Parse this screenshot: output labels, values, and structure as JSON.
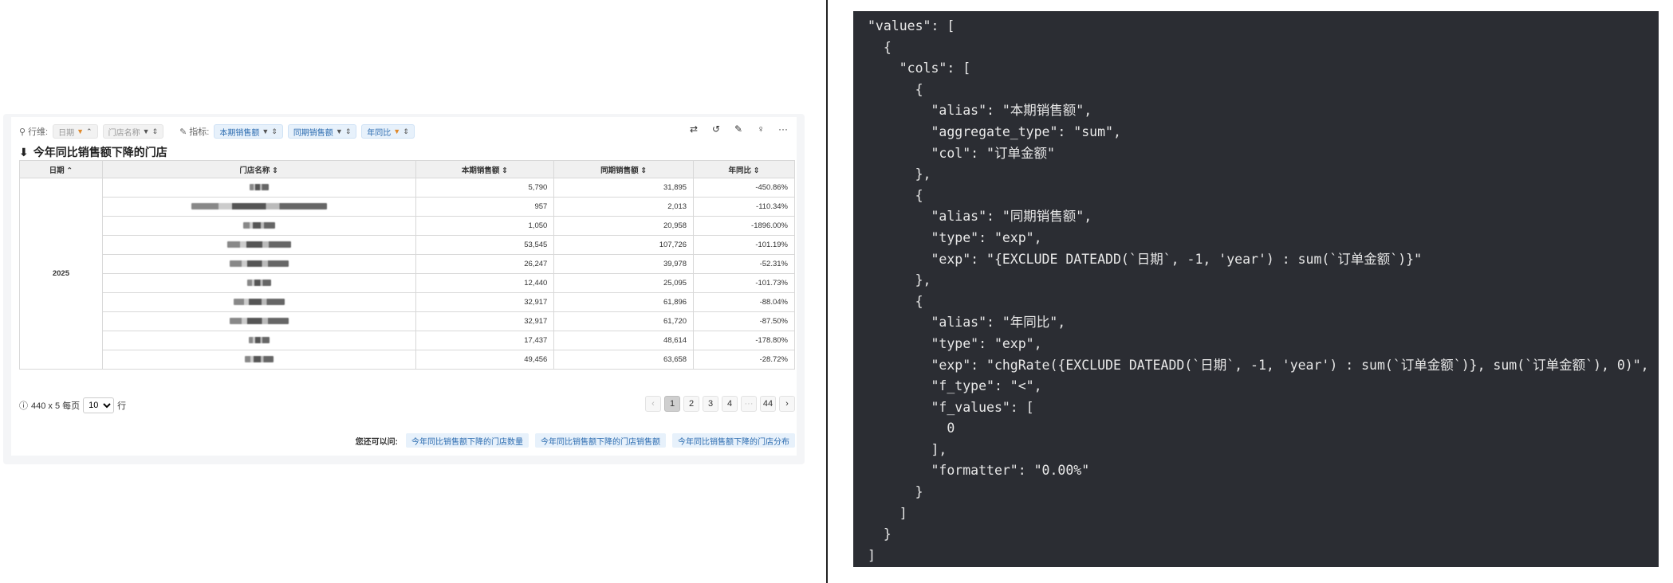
{
  "toolbar": {
    "row_label": "行维:",
    "row_chips": [
      {
        "label": "日期",
        "icon": "filter-sort-asc"
      },
      {
        "label": "门店名称",
        "icon": "filter-sort"
      }
    ],
    "metric_label": "指标:",
    "metric_chips": [
      {
        "label": "本期销售额"
      },
      {
        "label": "同期销售额"
      },
      {
        "label": "年同比"
      }
    ],
    "tools": [
      "shuffle-icon",
      "refresh-icon",
      "edit-icon",
      "bulb-icon",
      "more-icon"
    ]
  },
  "title": "今年同比销售额下降的门店",
  "table": {
    "headers": [
      "日期",
      "门店名称",
      "本期销售额",
      "同期销售额",
      "年同比"
    ],
    "year": "2025",
    "rows": [
      {
        "current": "5,790",
        "previous": "31,895",
        "yoy": "-450.86%"
      },
      {
        "current": "957",
        "previous": "2,013",
        "yoy": "-110.34%"
      },
      {
        "current": "1,050",
        "previous": "20,958",
        "yoy": "-1896.00%"
      },
      {
        "current": "53,545",
        "previous": "107,726",
        "yoy": "-101.19%"
      },
      {
        "current": "26,247",
        "previous": "39,978",
        "yoy": "-52.31%"
      },
      {
        "current": "12,440",
        "previous": "25,095",
        "yoy": "-101.73%"
      },
      {
        "current": "32,917",
        "previous": "61,896",
        "yoy": "-88.04%"
      },
      {
        "current": "32,917",
        "previous": "61,720",
        "yoy": "-87.50%"
      },
      {
        "current": "17,437",
        "previous": "48,614",
        "yoy": "-178.80%"
      },
      {
        "current": "49,456",
        "previous": "63,658",
        "yoy": "-28.72%"
      }
    ]
  },
  "pagination": {
    "summary": "440 x 5 每页",
    "page_size": "10",
    "rows_suffix": "行",
    "pages": [
      "1",
      "2",
      "3",
      "4",
      "···",
      "44"
    ],
    "current": "1"
  },
  "suggestions": {
    "label": "您还可以问:",
    "items": [
      "今年同比销售额下降的门店数量",
      "今年同比销售额下降的门店销售额",
      "今年同比销售额下降的门店分布"
    ]
  },
  "code_lines": [
    "\"values\": [",
    "  {",
    "    \"cols\": [",
    "      {",
    "        \"alias\": \"本期销售额\",",
    "        \"aggregate_type\": \"sum\",",
    "        \"col\": \"订单金额\"",
    "      },",
    "      {",
    "        \"alias\": \"同期销售额\",",
    "        \"type\": \"exp\",",
    "        \"exp\": \"{EXCLUDE DATEADD(`日期`, -1, 'year') : sum(`订单金额`)}\"",
    "      },",
    "      {",
    "        \"alias\": \"年同比\",",
    "        \"type\": \"exp\",",
    "        \"exp\": \"chgRate({EXCLUDE DATEADD(`日期`, -1, 'year') : sum(`订单金额`)}, sum(`订单金额`), 0)\",",
    "        \"f_type\": \"<\",",
    "        \"f_values\": [",
    "          0",
    "        ],",
    "        \"formatter\": \"0.00%\"",
    "      }",
    "    ]",
    "  }",
    "]"
  ]
}
